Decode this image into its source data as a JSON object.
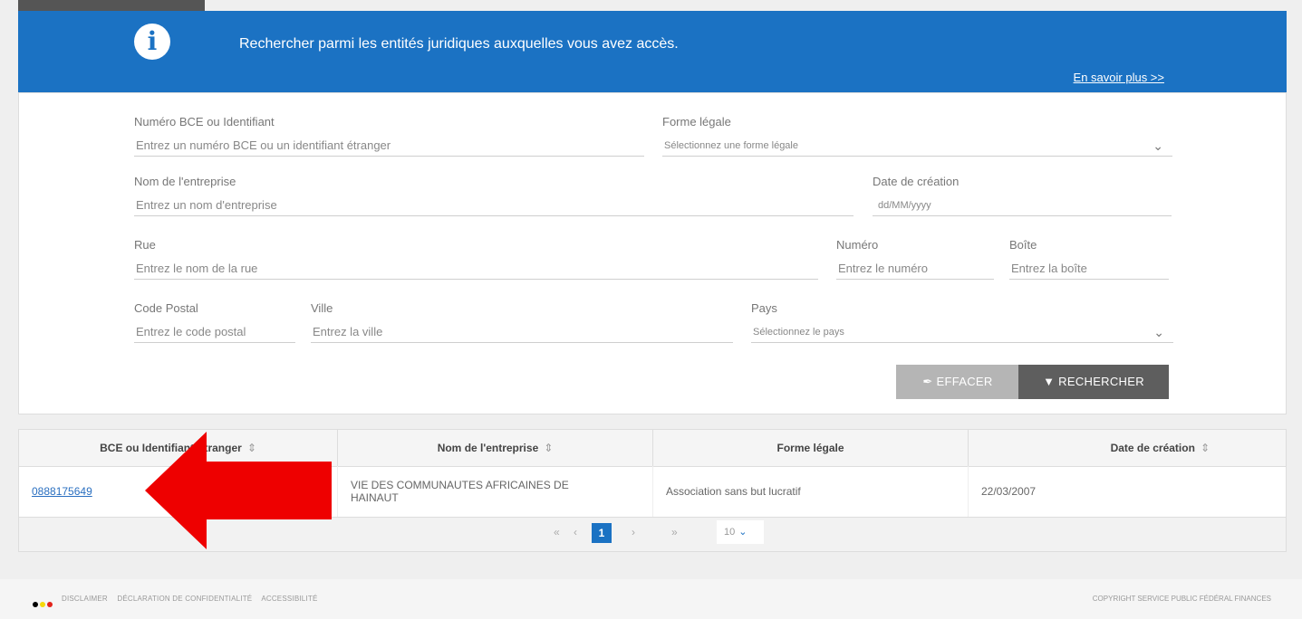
{
  "banner": {
    "message": "Rechercher parmi les entités juridiques auxquelles vous avez accès.",
    "more_link": "En savoir plus >>",
    "bg_color": "#1b72c3"
  },
  "form": {
    "bce": {
      "label": "Numéro BCE ou Identifiant",
      "placeholder": "Entrez un numéro BCE ou un identifiant étranger"
    },
    "legal_form": {
      "label": "Forme légale",
      "placeholder": "Sélectionnez une forme légale"
    },
    "company_name": {
      "label": "Nom de l'entreprise",
      "placeholder": "Entrez un nom d'entreprise"
    },
    "creation_date": {
      "label": "Date de création",
      "placeholder": "dd/MM/yyyy"
    },
    "street": {
      "label": "Rue",
      "placeholder": "Entrez le nom de la rue"
    },
    "number": {
      "label": "Numéro",
      "placeholder": "Entrez le numéro"
    },
    "box": {
      "label": "Boîte",
      "placeholder": "Entrez la boîte"
    },
    "postal_code": {
      "label": "Code Postal",
      "placeholder": "Entrez le code postal"
    },
    "city": {
      "label": "Ville",
      "placeholder": "Entrez la ville"
    },
    "country": {
      "label": "Pays",
      "placeholder": "Sélectionnez le pays"
    },
    "clear_button": "EFFACER",
    "search_button": "RECHERCHER"
  },
  "table": {
    "headers": [
      "BCE ou Identifiant Étranger",
      "Nom de l'entreprise",
      "Forme légale",
      "Date de création"
    ],
    "rows": [
      {
        "bce": "0888175649",
        "name": "VIE DES COMMUNAUTES AFRICAINES DE HAINAUT",
        "legal_form": "Association sans but lucratif",
        "date": "22/03/2007"
      }
    ],
    "pager": {
      "first": "«",
      "prev": "‹",
      "current": "1",
      "next": "›",
      "last": "»",
      "page_size": "10"
    }
  },
  "footer": {
    "links": [
      "DISCLAIMER",
      "DÉCLARATION DE CONFIDENTIALITÉ",
      "ACCESSIBILITÉ"
    ],
    "copyright": "COPYRIGHT SERVICE PUBLIC FÉDÉRAL FINANCES",
    "flag_colors": [
      "#000000",
      "#f5d90a",
      "#e2231a"
    ]
  },
  "annotation": {
    "arrow_color": "#ee0000"
  }
}
